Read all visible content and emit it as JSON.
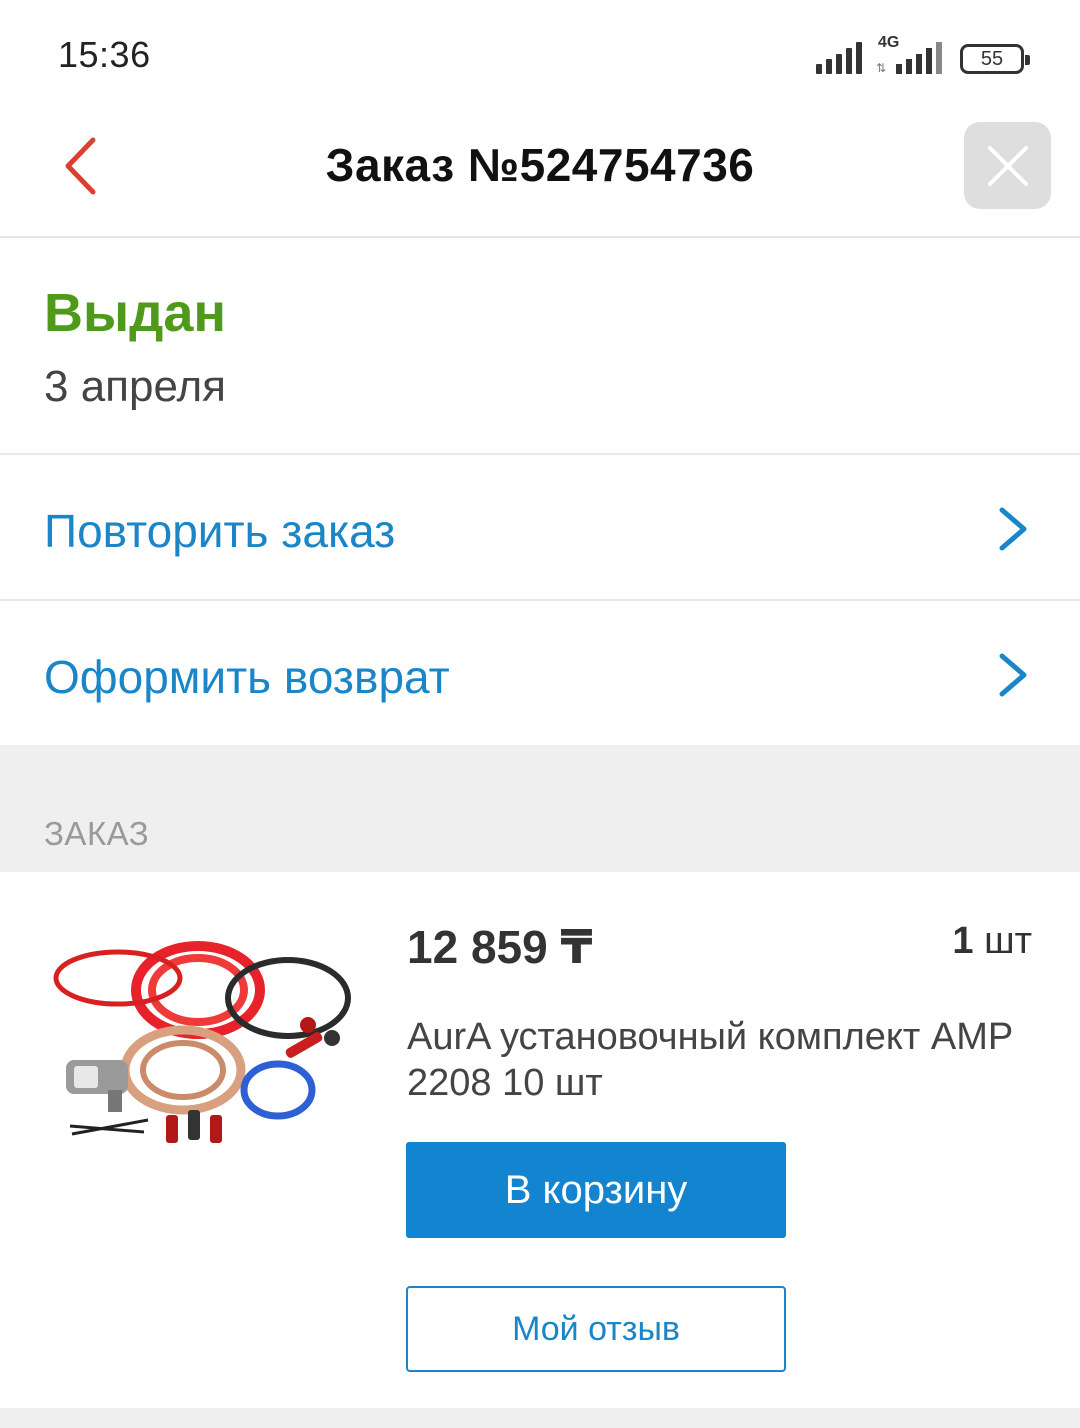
{
  "status_bar": {
    "time": "15:36",
    "network_label": "4G",
    "battery": "55",
    "icons": [
      "signal-icon",
      "signal-4g-icon",
      "battery-icon"
    ]
  },
  "header": {
    "title": "Заказ №524754736",
    "back_icon": "chevron-left-icon",
    "close_icon": "close-icon",
    "accent_color": "#d9402f"
  },
  "order": {
    "status": "Выдан",
    "status_color": "#4f9a1a",
    "date": "3 апреля"
  },
  "actions": [
    {
      "label": "Повторить заказ",
      "icon": "chevron-right-icon"
    },
    {
      "label": "Оформить возврат",
      "icon": "chevron-right-icon"
    }
  ],
  "section": {
    "title": "ЗАКАЗ"
  },
  "product": {
    "price": "12 859 ₸",
    "qty_number": "1",
    "qty_unit": "шт",
    "name": "AurA установочный комплект AMP 2208 10 шт",
    "image": "amp-wiring-kit-image",
    "cart_button": "В корзину",
    "review_button": "Мой отзыв",
    "link_color": "#1a86c8",
    "button_color": "#1384d0"
  }
}
